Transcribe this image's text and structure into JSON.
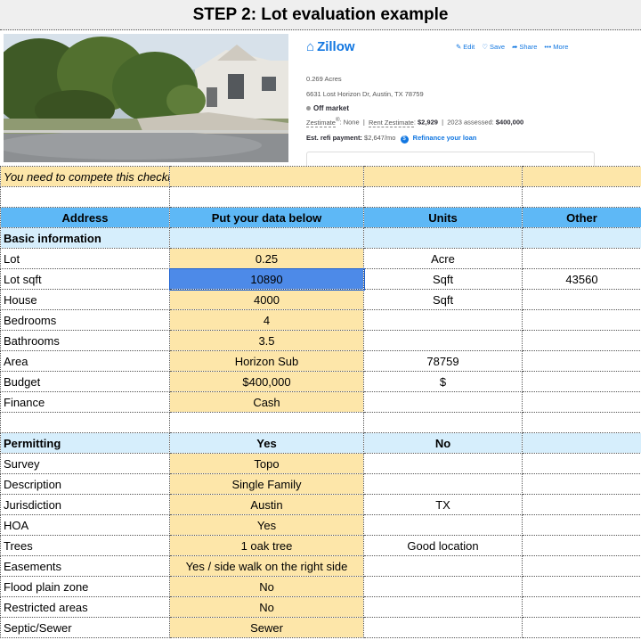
{
  "title": "STEP 2: Lot evaluation example",
  "listing": {
    "brand": "Zillow",
    "actions": [
      "Edit",
      "Save",
      "Share",
      "More"
    ],
    "acres": "0.269 Acres",
    "address": "6631 Lost Horizon Dr, Austin, TX 78759",
    "status": "Off market",
    "zestimate_label": "Zestimate",
    "zestimate_sup": "®",
    "zestimate_value": ": None",
    "rent_label": "Rent Zestimate",
    "rent_value": "$2,929",
    "assessed_label": "2023 assessed:",
    "assessed_value": "$400,000",
    "refi_label": "Est. refi payment:",
    "refi_value": "$2,647/mo",
    "refi_link": "Refinance your loan"
  },
  "notice": "You need to compete this checklist for every lot you want to buy",
  "header": [
    "Address",
    "Put your data below",
    "Units",
    "Other"
  ],
  "basic": {
    "title": "Basic information",
    "rows": [
      {
        "label": "Lot",
        "value": "0.25",
        "unit": "Acre",
        "other": ""
      },
      {
        "label": "Lot sqft",
        "value": "10890",
        "unit": "Sqft",
        "other": "43560",
        "selected": true
      },
      {
        "label": "House",
        "value": "4000",
        "unit": "Sqft",
        "other": ""
      },
      {
        "label": "Bedrooms",
        "value": "4",
        "unit": "",
        "other": ""
      },
      {
        "label": "Bathrooms",
        "value": "3.5",
        "unit": "",
        "other": ""
      },
      {
        "label": "Area",
        "value": "Horizon Sub",
        "unit": "78759",
        "other": ""
      },
      {
        "label": "Budget",
        "value": "$400,000",
        "unit": "$",
        "other": ""
      },
      {
        "label": "Finance",
        "value": "Cash",
        "unit": "",
        "other": ""
      }
    ]
  },
  "permitting": {
    "title": "Permitting",
    "col_yes": "Yes",
    "col_no": "No",
    "rows": [
      {
        "label": "Survey",
        "value": "Topo",
        "unit": "",
        "other": ""
      },
      {
        "label": "Description",
        "value": "Single Family",
        "unit": "",
        "other": ""
      },
      {
        "label": "Jurisdiction",
        "value": "Austin",
        "unit": "TX",
        "other": ""
      },
      {
        "label": "HOA",
        "value": "Yes",
        "unit": "",
        "other": ""
      },
      {
        "label": "Trees",
        "value": "1 oak tree",
        "unit": "Good location",
        "other": ""
      },
      {
        "label": "Easements",
        "value": "Yes / side walk on the right side",
        "unit": "",
        "other": ""
      },
      {
        "label": "Flood plain zone",
        "value": "No",
        "unit": "",
        "other": ""
      },
      {
        "label": "Restricted areas",
        "value": "No",
        "unit": "",
        "other": ""
      },
      {
        "label": "Septic/Sewer",
        "value": "Sewer",
        "unit": "",
        "other": ""
      }
    ]
  },
  "colors": {
    "header_blue": "#5eb8f6",
    "section_blue": "#d6eefc",
    "data_yellow": "#fde6a9",
    "selected_blue": "#4d8ae8",
    "zillow_blue": "#1277e1"
  }
}
